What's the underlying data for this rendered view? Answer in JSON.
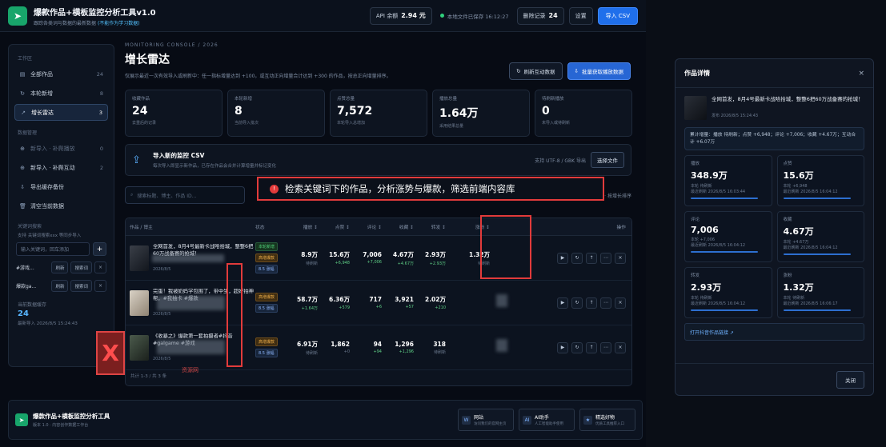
{
  "app": {
    "title": "爆款作品+横板监控分析工具v1.0",
    "subtitle": "跟踪各类词与数据的最新数据",
    "subtitle_hl": "(不能作为学习数据)",
    "api_label": "API 余额",
    "api_value": "2.94 元",
    "saved": "本地文件已保存 16:12:27",
    "deleted_label": "删除记录",
    "deleted_value": "24",
    "settings": "设置",
    "import_csv": "导入 CSV"
  },
  "sidebar": {
    "section1": "工作区",
    "items": [
      {
        "label": "全部作品",
        "count": "24",
        "icon": "▤"
      },
      {
        "label": "本轮新增",
        "count": "8",
        "icon": "↻"
      },
      {
        "label": "增长雷达",
        "count": "3",
        "icon": "↗"
      }
    ],
    "section2": "数据管理",
    "items2": [
      {
        "label": "新导入 · 补爬播放",
        "count": "0",
        "icon": "⊕"
      },
      {
        "label": "新导入 · 补爬互动",
        "count": "2",
        "icon": "⊕"
      },
      {
        "label": "导出缓存备份",
        "count": "",
        "icon": "⇩"
      },
      {
        "label": "清空当前数据",
        "count": "",
        "icon": "🗑"
      }
    ],
    "section3": "关键词搜索",
    "kw_hint": "支持 关键词搜索xxx 等同步导入",
    "kw_placeholder": "输入关键词，回车添加",
    "kw_add": "+",
    "keywords": [
      {
        "name": "#游戏...",
        "b1": "刷新",
        "b2": "搜索词",
        "x": "×"
      },
      {
        "name": "爆款ga...",
        "b1": "刷新",
        "b2": "搜索词",
        "x": "×"
      }
    ],
    "last_label": "当前数据缓存",
    "last_num": "24",
    "last_ts": "最新导入 2026/8/5 15:24:43"
  },
  "main": {
    "kicker": "MONITORING CONSOLE / 2026",
    "title": "增长雷达",
    "desc": "仅展示最近一次有效导入或刷新中：任一指标增量达到 +100，或互动正向增量合计达到 +300 的作品，按总正向增量排序。",
    "btn_refresh": "刷新互动数据",
    "btn_batch": "批量获取播放数据",
    "cards": [
      {
        "lbl": "收藏作品",
        "val": "24",
        "sub": "去重后的记录"
      },
      {
        "lbl": "本轮新增",
        "val": "8",
        "sub": "当前导入批次"
      },
      {
        "lbl": "点赞总量",
        "val": "7,572",
        "sub": "本轮导入总增加"
      },
      {
        "lbl": "播放总量",
        "val": "1.64万",
        "sub": "采用结果总量"
      },
      {
        "lbl": "待刷新播放",
        "val": "0",
        "sub": "未导入或待刷新"
      }
    ],
    "import_title": "导入新的监控 CSV",
    "import_sub": "每次导入即显示新作品，已存在作品会合并计算增量并标记变化",
    "import_hint": "支持 UTF-8 / GBK 导出",
    "import_btn": "选择文件",
    "search_placeholder": "搜索标题、博主、作品 ID...",
    "filter_text": "全部状态 · 按增长排序",
    "banner": "检索关键词下的作品，分析涨势与爆款，筛选前端内容库"
  },
  "table": {
    "headers": [
      "作品 / 博主",
      "状态",
      "播放 ↕",
      "点赞 ↕",
      "评论 ↕",
      "收藏 ↕",
      "转发 ↕",
      "涨粉 ↕",
      "操作"
    ],
    "rows": [
      {
        "title": "全网首发，8月4号最新卡战哈拾城，整整6把60万战备赛的抢城！",
        "meta": "2026/8/5",
        "tags": [
          "本轮新增",
          "高增爆款",
          "8.5 涨幅"
        ],
        "vals": [
          [
            "8.9万",
            "待刷新"
          ],
          [
            "15.6万",
            "+6,948"
          ],
          [
            "7,006",
            "+7,006"
          ],
          [
            "4.67万",
            "+4.67万"
          ],
          [
            "2.93万",
            "+2.93万"
          ],
          [
            "1.32万",
            "待刷新"
          ]
        ]
      },
      {
        "title": "完蛋！我被奶妈学包围了，带中生，超好拍神帮，#我抽卡 #爆款",
        "meta": "2026/8/5",
        "tags": [
          "高增爆款",
          "8.5 涨幅"
        ],
        "vals": [
          [
            "58.7万",
            "+1.64万"
          ],
          [
            "6.36万",
            "+579"
          ],
          [
            "717",
            "+6"
          ],
          [
            "3,921",
            "+57"
          ],
          [
            "2.02万",
            "+210"
          ],
          [
            "",
            ""
          ]
        ]
      },
      {
        "title": "《收暴之》爆款第一套拍摄者#抖音 #galgame #游戏",
        "meta": "2026/8/5",
        "tags": [
          "高增爆款",
          "8.5 涨幅"
        ],
        "vals": [
          [
            "6.91万",
            "待刷新"
          ],
          [
            "1,862",
            "+0"
          ],
          [
            "94",
            "+94"
          ],
          [
            "1,296",
            "+1,296"
          ],
          [
            "318",
            "待刷新"
          ],
          [
            "",
            ""
          ]
        ]
      }
    ],
    "footer": "共计 1-3 / 共 3 条",
    "actions": [
      "▶",
      "↻",
      "↑",
      "⋯",
      "×"
    ]
  },
  "watermark": {
    "text": "资源网",
    "mark": "X"
  },
  "footer": {
    "title": "爆款作品+横板监控分析工具",
    "sub": "版本 1.0 · 内容创作数据工作台",
    "links": [
      {
        "icon": "W",
        "t": "网站",
        "s": "访问我们的官网主页"
      },
      {
        "icon": "AI",
        "t": "AI助手",
        "s": "人工智能助手使用"
      },
      {
        "icon": "★",
        "t": "精选好物",
        "s": "优质工具推荐入口"
      }
    ]
  },
  "panel": {
    "title": "作品详情",
    "close": "×",
    "work_title": "全网首发，8月4号最新卡战哈拾城，整整6把60万战备赛的抢城！",
    "work_meta": "发布 2026/8/5 15:24:43",
    "summary": "累计增量：播放 待刷新；点赞 +6,948；评论 +7,006；收藏 +4.67万；互动合计 +6.07万",
    "metrics": [
      {
        "l": "播放",
        "v": "348.9万",
        "s1": "本轮 待刷新",
        "s2": "最近刷新 2026/8/5 16:03:44"
      },
      {
        "l": "点赞",
        "v": "15.6万",
        "s1": "本轮 +6,948",
        "s2": "最近刷新 2026/8/5 16:04:12"
      },
      {
        "l": "评论",
        "v": "7,006",
        "s1": "本轮 +7,006",
        "s2": "最近刷新 2026/8/5 16:04:12"
      },
      {
        "l": "收藏",
        "v": "4.67万",
        "s1": "本轮 +4.67万",
        "s2": "最近刷新 2026/8/5 16:04:12"
      },
      {
        "l": "转发",
        "v": "2.93万",
        "s1": "本轮 待刷新",
        "s2": "最近刷新 2026/8/5 16:04:12"
      },
      {
        "l": "涨粉",
        "v": "1.32万",
        "s1": "本轮 待刷新",
        "s2": "最近刷新 2026/8/5 16:06:17"
      }
    ],
    "link": "打开抖音作品链接 ↗",
    "close_btn": "关闭"
  }
}
